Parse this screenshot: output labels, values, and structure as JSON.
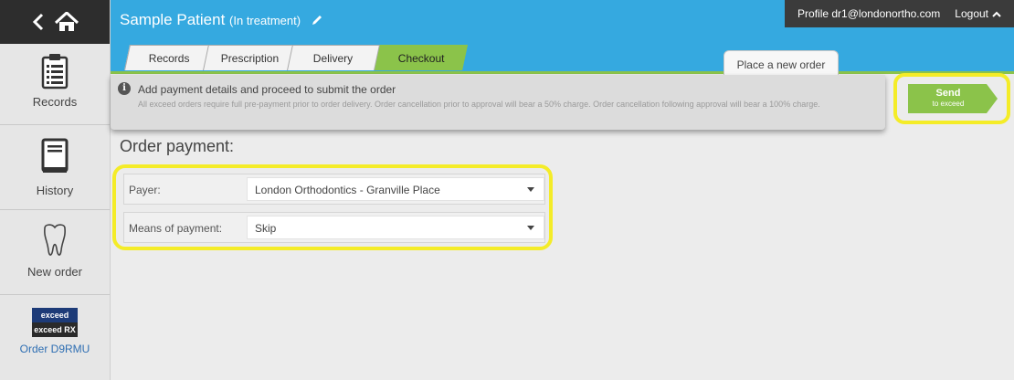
{
  "sidebar": {
    "records_label": "Records",
    "history_label": "History",
    "new_order_label": "New order",
    "brand": {
      "line1": "exceed",
      "line2": "exceed RX"
    },
    "order_link": "Order D9RMU"
  },
  "header": {
    "patient_name": "Sample Patient",
    "patient_status": "(In treatment)",
    "profile_text": "Profile dr1@londonortho.com",
    "logout_label": "Logout"
  },
  "tabs": {
    "records": "Records",
    "prescription": "Prescription",
    "delivery": "Delivery",
    "checkout": "Checkout",
    "place_order": "Place a new order"
  },
  "info": {
    "title": "Add payment details and proceed to submit the order",
    "text": "All exceed orders require full pre-payment prior to order delivery. Order cancellation prior to approval will bear a 50% charge. Order cancellation following approval will bear a 100% charge."
  },
  "send_button": {
    "line1": "Send",
    "line2": "to exceed"
  },
  "payment": {
    "title": "Order payment:",
    "payer_label": "Payer:",
    "payer_value": "London Orthodontics - Granville Place",
    "means_label": "Means of payment:",
    "means_value": "Skip"
  },
  "colors": {
    "header_blue": "#35a9e0",
    "checkout_green": "#8bc34a",
    "highlight_yellow": "#f4ec28",
    "profile_bar": "#3b3b3b"
  }
}
